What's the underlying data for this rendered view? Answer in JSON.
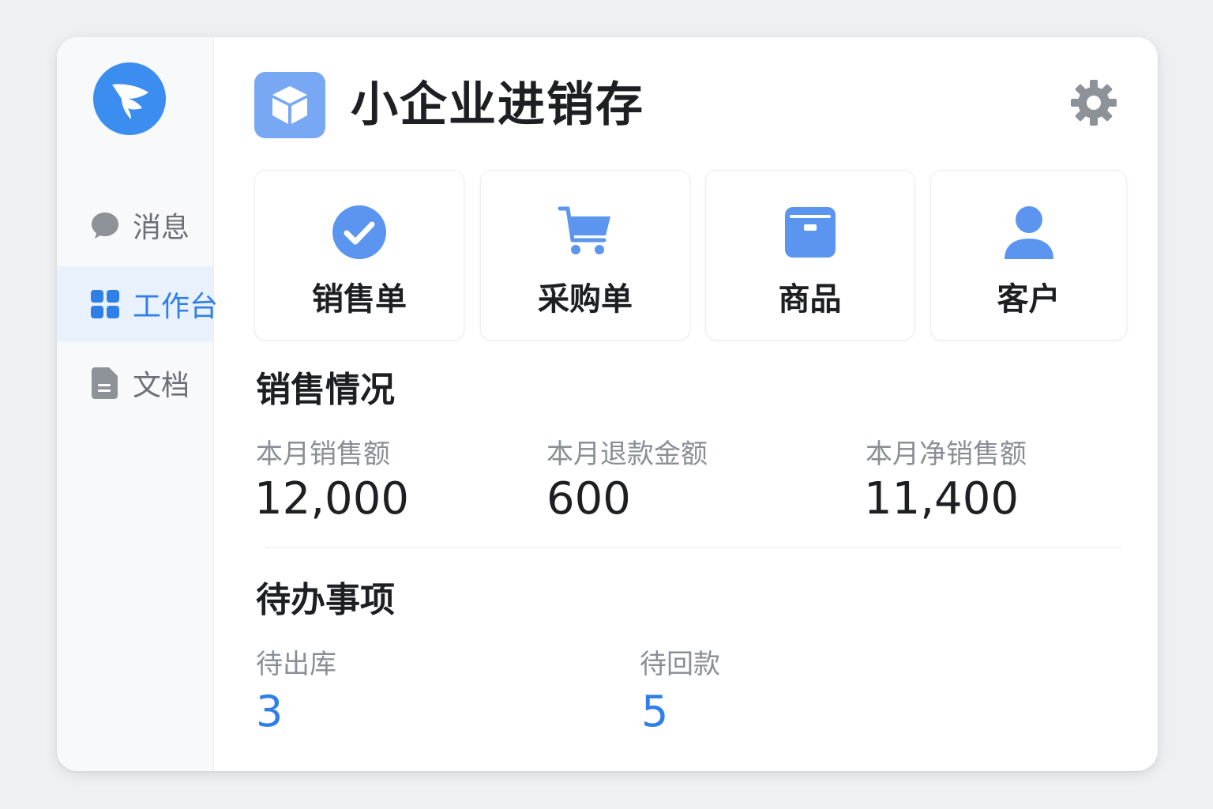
{
  "app": {
    "title": "小企业进销存"
  },
  "sidebar": {
    "items": [
      {
        "label": "消息",
        "icon": "chat-bubble-icon",
        "active": false
      },
      {
        "label": "工作台",
        "icon": "grid-icon",
        "active": true
      },
      {
        "label": "文档",
        "icon": "document-icon",
        "active": false
      }
    ]
  },
  "tiles": [
    {
      "label": "销售单",
      "icon": "check-circle-icon"
    },
    {
      "label": "采购单",
      "icon": "cart-icon"
    },
    {
      "label": "商品",
      "icon": "box-icon"
    },
    {
      "label": "客户",
      "icon": "user-icon"
    }
  ],
  "sales": {
    "title": "销售情况",
    "stats": [
      {
        "label": "本月销售额",
        "value": "12,000"
      },
      {
        "label": "本月退款金额",
        "value": "600"
      },
      {
        "label": "本月净销售额",
        "value": "11,400"
      }
    ]
  },
  "todo": {
    "title": "待办事项",
    "items": [
      {
        "label": "待出库",
        "value": "3"
      },
      {
        "label": "待回款",
        "value": "5"
      }
    ]
  },
  "colors": {
    "accent": "#2f7fe8",
    "icon_blue": "#5b95ef",
    "background": "#eef0f3"
  }
}
